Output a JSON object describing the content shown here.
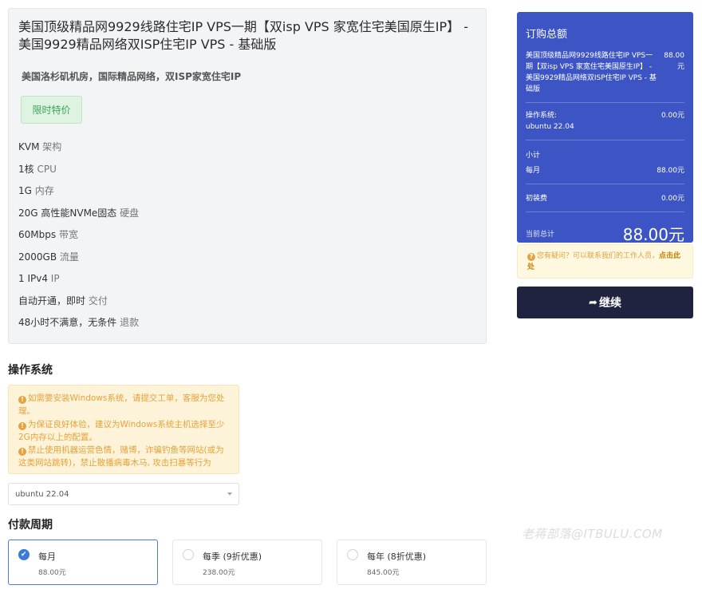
{
  "product": {
    "title": "美国顶级精品网9929线路住宅IP VPS一期【双isp VPS 家宽住宅美国原生IP】 - 美国9929精品网络双ISP住宅IP VPS - 基础版",
    "subtitle": "美国洛杉矶机房，国际精品网络，双ISP家宽住宅IP",
    "badge": "限时特价",
    "specs": [
      {
        "value": "KVM",
        "label": "架构"
      },
      {
        "value": "1核",
        "label": "CPU"
      },
      {
        "value": "1G",
        "label": "内存"
      },
      {
        "value": "20G 高性能NVMe固态",
        "label": "硬盘"
      },
      {
        "value": "60Mbps",
        "label": "带宽"
      },
      {
        "value": "2000GB",
        "label": "流量"
      },
      {
        "value": "1 IPv4",
        "label": "IP"
      },
      {
        "value": "自动开通，即时",
        "label": "交付"
      },
      {
        "value": "48小时不满意，无条件",
        "label": "退款"
      }
    ]
  },
  "os_section": {
    "title": "操作系统",
    "notices": [
      "如需要安装Windows系统，请提交工单，客服为您处理。",
      "为保证良好体验，建议为Windows系统主机选择至少2G内存以上的配置。",
      "禁止使用机器运营色情，赌博，诈骗钓鱼等网站(或为这类网站跳转)，禁止散播病毒木马, 攻击扫暴等行为"
    ],
    "selected_os": "ubuntu 22.04"
  },
  "billing": {
    "title": "付款周期",
    "options": [
      {
        "label": "每月",
        "price": "88.00元",
        "selected": true
      },
      {
        "label": "每季 (9折优惠)",
        "price": "238.00元",
        "selected": false
      },
      {
        "label": "每年 (8折优惠)",
        "price": "845.00元",
        "selected": false
      }
    ]
  },
  "watermark": "老蒋部落@ITBULU.COM",
  "summary": {
    "heading": "订购总额",
    "product_name": "美国顶级精品网9929线路住宅IP VPS一期【双isp VPS 家宽住宅美国原生IP】 - 美国9929精品网络双ISP住宅IP VPS - 基础版",
    "product_price": "88.00元",
    "os_label": "操作系统:",
    "os_value": "ubuntu 22.04",
    "os_price": "0.00元",
    "subtotal_label": "小计",
    "monthly_label": "每月",
    "monthly_price": "88.00元",
    "setup_label": "初装费",
    "setup_price": "0.00元",
    "total_label": "当前总计",
    "total_value": "88.00元",
    "color": "#3d55c4"
  },
  "help": {
    "text": "您有疑问？可以联系我们的工作人员，",
    "link": "点击此处"
  },
  "continue_button": {
    "label": "继续",
    "color": "#1f2340"
  }
}
